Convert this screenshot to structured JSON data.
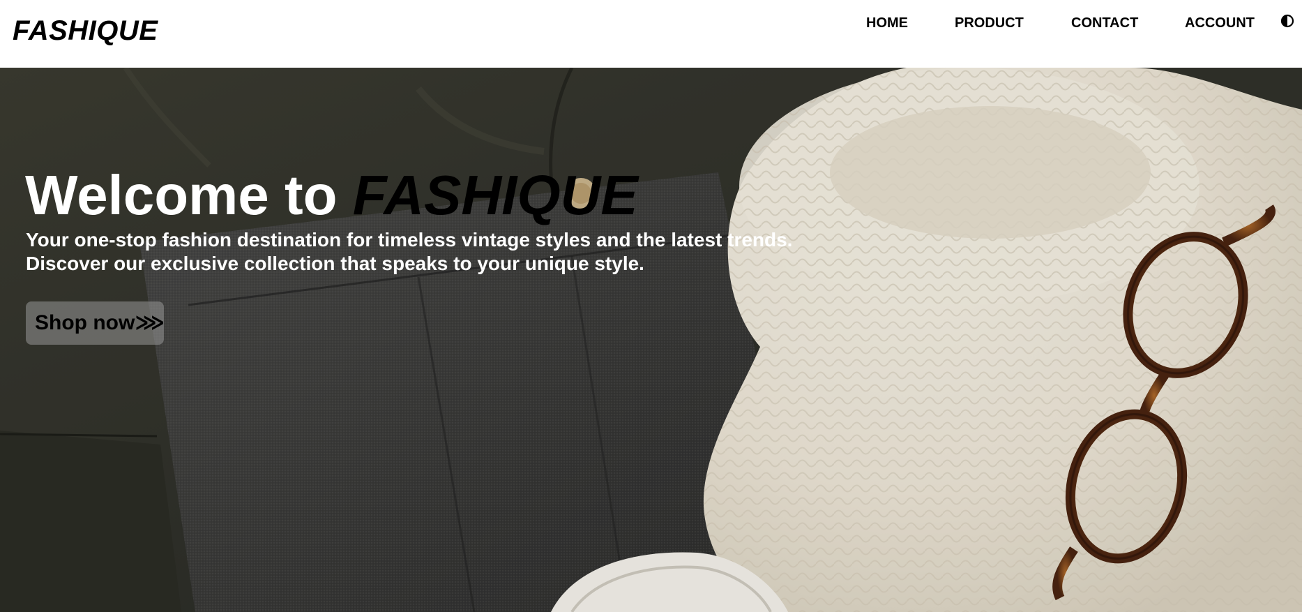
{
  "header": {
    "logo": "FASHIQUE",
    "nav": {
      "home": "HOME",
      "product": "PRODUCT",
      "contact": "CONTACT",
      "account": "ACCOUNT"
    },
    "theme_toggle_icon": "half-circle-contrast-icon"
  },
  "hero": {
    "title_prefix": "Welcome to ",
    "title_brand": "FASHIQUE",
    "subtitle_line1": "Your one-stop fashion destination for timeless vintage styles and the latest trends.",
    "subtitle_line2": "Discover our exclusive collection that speaks to your unique style.",
    "cta_label": "Shop now",
    "cta_arrow": "⋙"
  },
  "colors": {
    "header_bg": "#ffffff",
    "hero_text": "#ffffff",
    "brand_text": "#000000",
    "cta_bg": "rgba(150,150,150,0.55)"
  }
}
